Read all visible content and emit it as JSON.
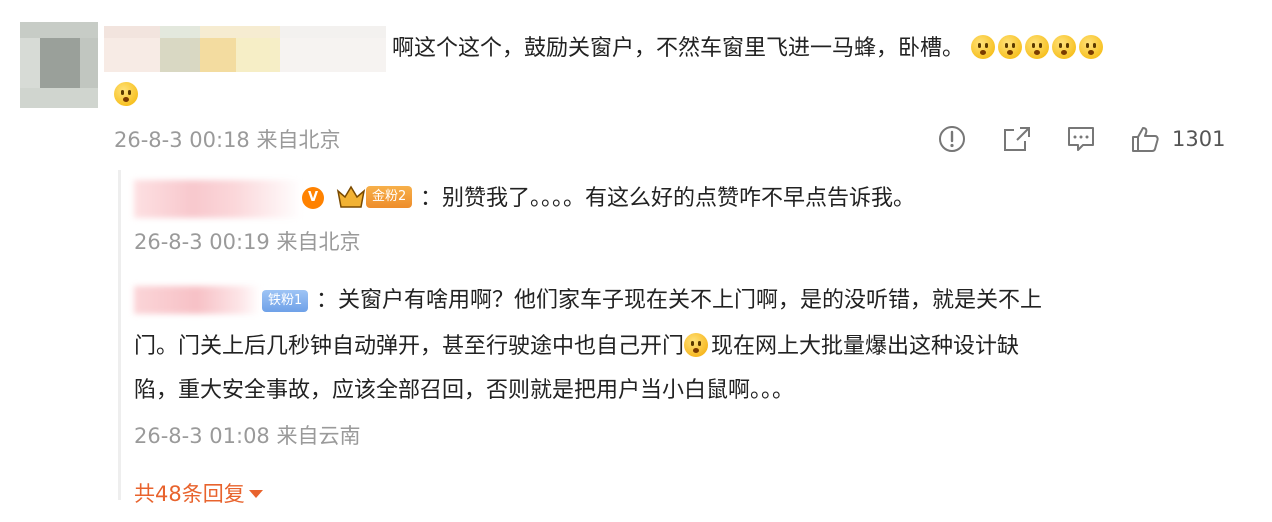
{
  "main_comment": {
    "text_line1": "啊这个这个，鼓励关窗户，不然车窗里飞进一马蜂，卧槽。",
    "emoji_name": "kiss-emoji",
    "time": "26-8-3 00:18",
    "source": "来自北京",
    "like_count": "1301"
  },
  "replies": [
    {
      "badge": "金粉2",
      "text": "：别赞我了。。。。有这么好的点赞咋不早点告诉我。",
      "time": "26-8-3 00:19",
      "source": "来自北京"
    },
    {
      "badge": "铁粉1",
      "text_line1": "：关窗户有啥用啊？他们家车子现在关不上门啊，是的没听错，就是关不上",
      "text_line2a": "门。门关上后几秒钟自动弹开，甚至行驶途中也自己开门",
      "text_line2b": "现在网上大批量爆出这种设计缺",
      "text_line3": "陷，重大安全事故，应该全部召回，否则就是把用户当小白鼠啊。。。",
      "time": "26-8-3 01:08",
      "source": "来自云南"
    }
  ],
  "more_replies": "共48条回复",
  "colors": {
    "accent": "#e8632d",
    "meta_gray": "#9a9a9a",
    "gold_badge": "#f0972f",
    "iron_badge": "#7fadec"
  }
}
